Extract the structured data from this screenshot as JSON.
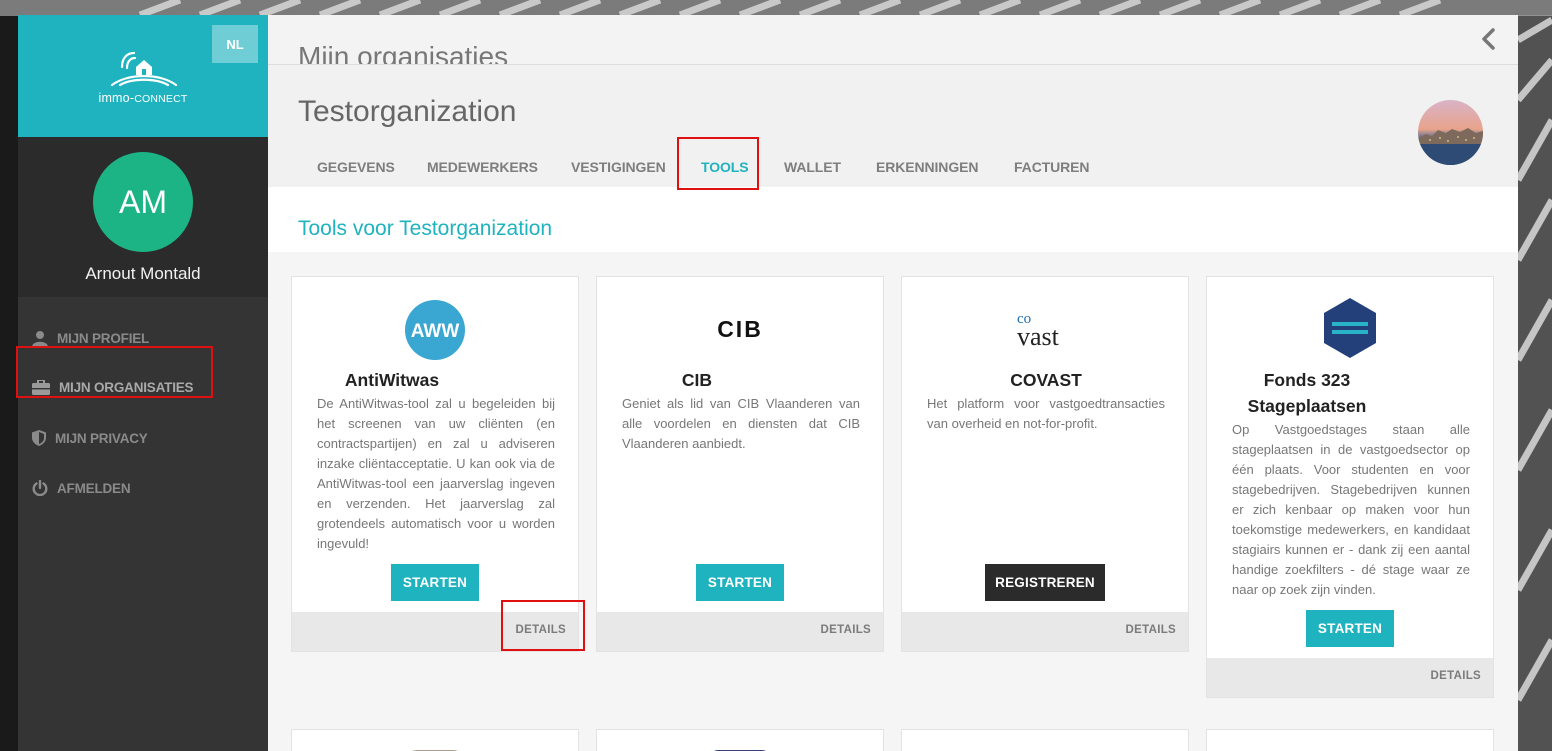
{
  "app": {
    "logo_main": "immo-",
    "logo_sub": "CONNECT",
    "language": "NL",
    "accent_color": "#1fb3c0"
  },
  "user": {
    "initials": "AM",
    "name": "Arnout Montald"
  },
  "sidebar": {
    "items": [
      {
        "label": "MIJN PROFIEL",
        "icon": "user-icon"
      },
      {
        "label": "MIJN ORGANISATIES",
        "icon": "briefcase-icon",
        "active": true
      },
      {
        "label": "MIJN PRIVACY",
        "icon": "shield-icon"
      },
      {
        "label": "AFMELDEN",
        "icon": "power-icon"
      }
    ]
  },
  "page": {
    "section_title": "Mijn organisaties",
    "org_name": "Testorganization",
    "tabs": [
      "GEGEVENS",
      "MEDEWERKERS",
      "VESTIGINGEN",
      "TOOLS",
      "WALLET",
      "ERKENNINGEN",
      "FACTUREN"
    ],
    "active_tab": "TOOLS",
    "tools_heading": "Tools voor Testorganization"
  },
  "tools": [
    {
      "title": "AntiWitwas",
      "logo_text": "AWW",
      "description": "De AntiWitwas-tool zal u begeleiden bij het screenen van uw cliënten (en contractspartijen) en zal u adviseren inzake cliëntacceptatie. U kan ook via de AntiWitwas-tool een jaarverslag ingeven en verzenden. Het jaarverslag zal grotendeels automatisch voor u worden ingevuld!",
      "button": "STARTEN",
      "details": "DETAILS"
    },
    {
      "title": "CIB",
      "logo_text": "CIB",
      "description": "Geniet als lid van CIB Vlaanderen van alle voordelen en diensten dat CIB Vlaanderen aanbiedt.",
      "button": "STARTEN",
      "details": "DETAILS"
    },
    {
      "title": "COVAST",
      "logo_text_top": "co",
      "logo_text_bottom": "vast",
      "description": "Het platform voor vastgoedtransacties van overheid en not-for-profit.",
      "button": "REGISTREREN",
      "details": "DETAILS"
    },
    {
      "title_line1": "Fonds 323",
      "title_line2": "Stageplaatsen",
      "description": "Op Vastgoedstages staan alle stageplaatsen in de vastgoedsector op één plaats. Voor studenten en voor stagebedrijven. Stagebedrijven kunnen er zich kenbaar op maken voor hun toekomstige medewerkers, en kandidaat stagiairs kunnen er - dank zij een aantal handige zoekfilters - dé stage waar ze naar op zoek zijn vinden.",
      "button": "STARTEN",
      "details": "DETAILS"
    }
  ],
  "colors": {
    "sidebar_dark": "#2b2b2b",
    "nav_bg": "#343434",
    "button_teal": "#1fb3c0",
    "button_dark": "#2b2b2b",
    "avatar_green": "#1cb485",
    "highlight_red": "#e01010"
  }
}
